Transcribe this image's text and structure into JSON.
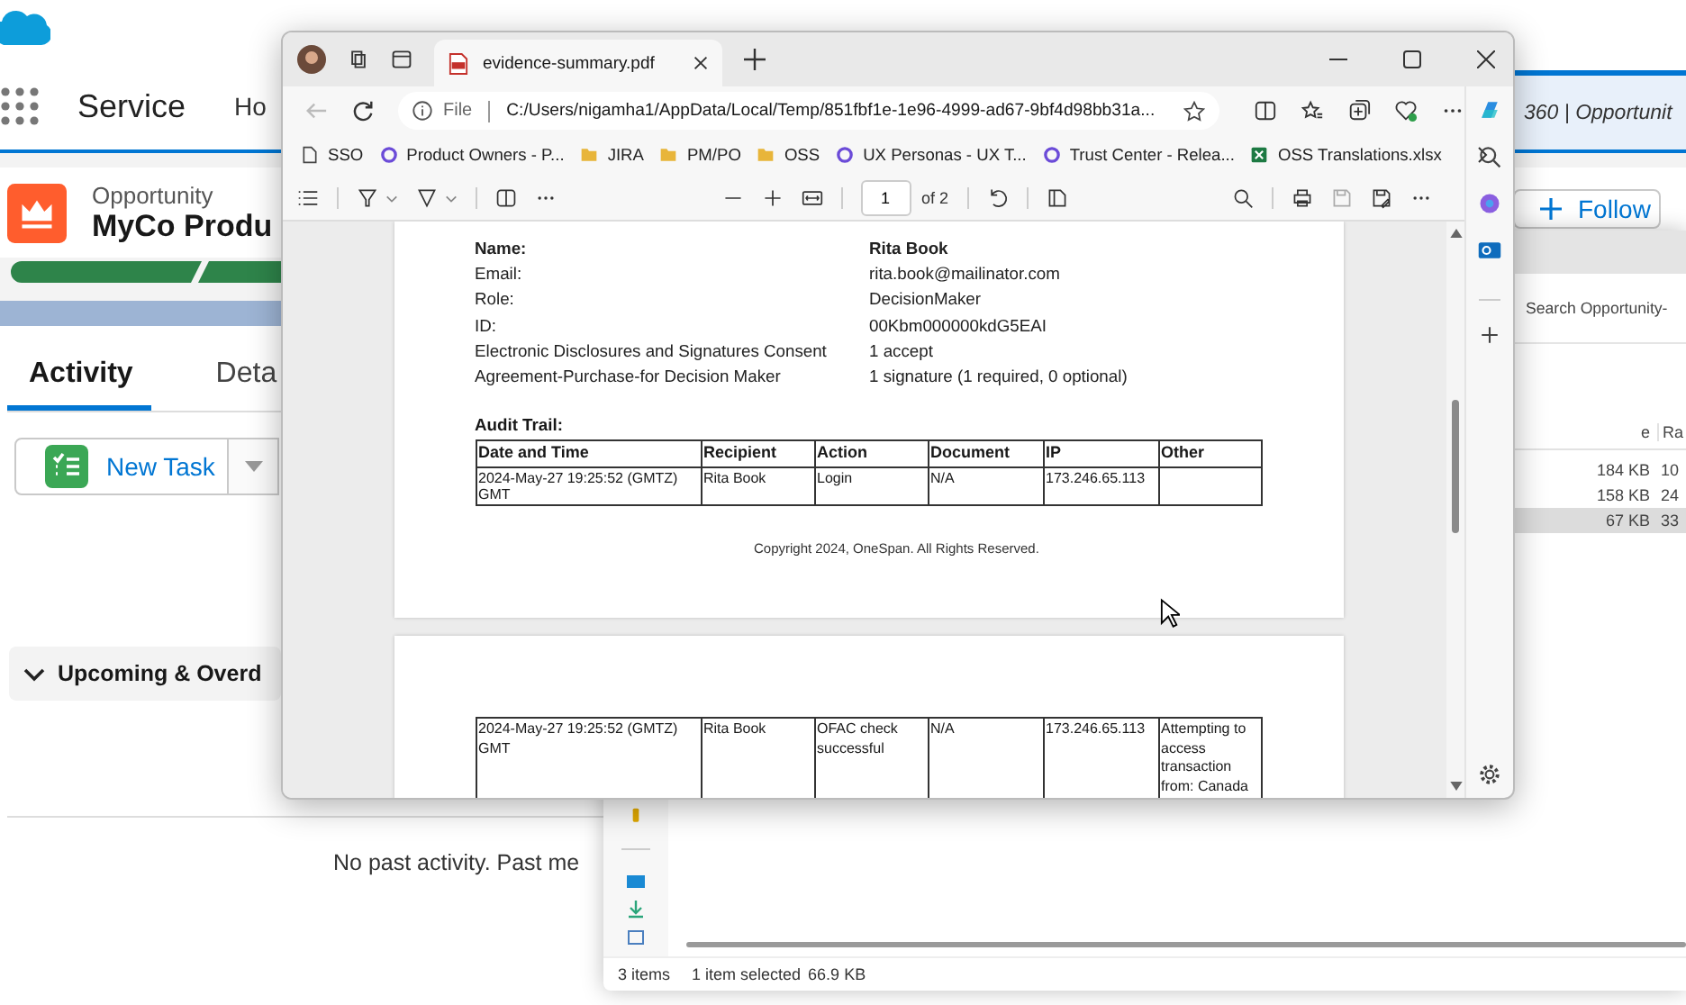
{
  "salesforce": {
    "app_name": "Service",
    "nav_items": [
      "Ho"
    ],
    "console_tab": "360 | Opportunit",
    "record_type": "Opportunity",
    "record_name": "MyCo Produ",
    "follow_button": "Follow",
    "tabs": [
      {
        "label": "Activity",
        "selected": true
      },
      {
        "label": "Deta",
        "selected": false
      }
    ],
    "new_task_button": "New Task",
    "section": {
      "title": "Upcoming & Overd",
      "expanded": true
    },
    "empty_message": "No past activity. Past me"
  },
  "explorer": {
    "search_placeholder": "Search Opportunity-",
    "columns": [
      "e",
      "Ra"
    ],
    "rows": [
      {
        "size": "184 KB",
        "column_2": "10",
        "selected": false
      },
      {
        "size": "158 KB",
        "column_2": "24",
        "selected": false
      },
      {
        "size": "67 KB",
        "column_2": "33",
        "selected": true
      }
    ],
    "status_bar": {
      "item_count": "3 items",
      "selection": "1 item selected",
      "selection_size": "66.9 KB"
    }
  },
  "browser": {
    "tabs": [
      {
        "title": "evidence-summary.pdf",
        "selected": true
      }
    ],
    "address": {
      "scheme": "File",
      "url": "C:/Users/nigamha1/AppData/Local/Temp/851fbf1e-1e96-4999-ad67-9bf4d98bb31a..."
    },
    "favorites": [
      {
        "label": "SSO",
        "kind": "page"
      },
      {
        "label": "Product Owners - P...",
        "kind": "site"
      },
      {
        "label": "JIRA",
        "kind": "folder"
      },
      {
        "label": "PM/PO",
        "kind": "folder"
      },
      {
        "label": "OSS",
        "kind": "folder"
      },
      {
        "label": "UX Personas - UX T...",
        "kind": "site"
      },
      {
        "label": "Trust Center - Relea...",
        "kind": "site"
      },
      {
        "label": "OSS Translations.xlsx",
        "kind": "excel"
      }
    ],
    "pdf_toolbar": {
      "page": "1",
      "page_count": "of 2"
    },
    "document": {
      "details": [
        {
          "label": "Name:",
          "value": "Rita Book",
          "kind": "heading"
        },
        {
          "label": "Email:",
          "value": "rita.book@mailinator.com",
          "kind": "plain"
        },
        {
          "label": "Role:",
          "value": "DecisionMaker",
          "kind": "plain"
        },
        {
          "label": "ID:",
          "value": "00Kbm000000kdG5EAI",
          "kind": "plain"
        },
        {
          "label": "Electronic Disclosures and Signatures Consent",
          "value": "1 accept",
          "kind": "plain"
        },
        {
          "label": "Agreement-Purchase-for Decision Maker",
          "value": "1 signature (1 required, 0 optional)",
          "kind": "plain"
        }
      ],
      "audit_title": "Audit Trail:",
      "audit_columns": [
        "Date and Time",
        "Recipient",
        "Action",
        "Document",
        "IP",
        "Other"
      ],
      "audit_rows": [
        [
          "2024-May-27 19:25:52 (GMTZ) GMT",
          "Rita Book",
          "Login",
          "N/A",
          "173.246.65.113",
          ""
        ]
      ],
      "copyright": "Copyright 2024, OneSpan. All Rights Reserved.",
      "page_2_rows": [
        [
          "2024-May-27 19:25:52 (GMTZ) GMT",
          "Rita Book",
          "OFAC check successful",
          "N/A",
          "173.246.65.113",
          "Attempting to access transaction from: Canada"
        ]
      ]
    }
  }
}
